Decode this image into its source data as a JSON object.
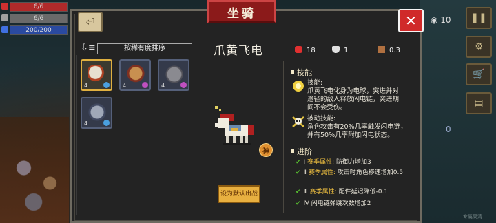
{
  "hud": {
    "rows": [
      {
        "name": "health",
        "text": "6/6",
        "fill": 1.0,
        "color": "#b02a2a",
        "icon_color": "#d03030"
      },
      {
        "name": "armor",
        "text": "6/6",
        "fill": 1.0,
        "color": "#6a6a6a",
        "icon_color": "#a0a0a0"
      },
      {
        "name": "energy",
        "text": "200/200",
        "fill": 1.0,
        "color": "#2a4aa0",
        "icon_color": "#4070e0"
      }
    ]
  },
  "right_hud": {
    "coin_count": "10",
    "ammo_count": "0",
    "watermark": "专属高清"
  },
  "panel": {
    "title": "坐骑",
    "back_icon": "back-arrow-icon",
    "close_icon": "close-icon"
  },
  "sort": {
    "label": "按稀有度排序",
    "icon": "sort-icon"
  },
  "mounts": [
    {
      "name": "horse-white",
      "level": "4",
      "selected": true,
      "gem_color": "#4aa0e0",
      "body_color": "#e8e0d0",
      "accent": "#b04020"
    },
    {
      "name": "lion-mount",
      "level": "4",
      "selected": false,
      "gem_color": "#c050c0",
      "body_color": "#c89050",
      "accent": "#803020"
    },
    {
      "name": "elephant-mount",
      "level": "4",
      "selected": false,
      "gem_color": "#c050c0",
      "body_color": "#8a8a90",
      "accent": "#505058"
    },
    {
      "name": "donkey-mount",
      "level": "4",
      "selected": false,
      "gem_color": "#4aa0e0",
      "body_color": "#a0a8b8",
      "accent": "#404860"
    }
  ],
  "detail": {
    "name": "爪黄飞电",
    "god_badge": "神",
    "equip_button": "设为默认出战",
    "stats": [
      {
        "icon": "heart-icon",
        "value": "18",
        "color": "#e03030"
      },
      {
        "icon": "shield-icon",
        "value": "1",
        "color": "#e0e0e0"
      },
      {
        "icon": "boot-icon",
        "value": "0.3",
        "color": "#b07040"
      }
    ]
  },
  "skills": {
    "title": "技能",
    "active": {
      "label": "技能:",
      "lines": [
        "爪黄飞电化身为电球，突进并对",
        "途径的敌人释放闪电链，突进期",
        "间不会受伤。"
      ]
    },
    "passive": {
      "label": "被动技能:",
      "lines": [
        "角色攻击有20%几率触发闪电链，",
        "并有50%几率附加闪电状态。"
      ]
    }
  },
  "advance": {
    "title": "进阶",
    "rows": [
      {
        "numeral": "Ⅰ",
        "tag": "赛季属性:",
        "text": "防御力增加3"
      },
      {
        "numeral": "Ⅱ",
        "tag": "赛季属性:",
        "text": "攻击时角色移速增加0.5"
      },
      {
        "numeral": "Ⅲ",
        "tag": "赛季属性:",
        "text": "配件延迟降低-0.1"
      },
      {
        "numeral": "Ⅳ",
        "tag": "",
        "text": "闪电链弹跳次数增加2"
      }
    ]
  }
}
